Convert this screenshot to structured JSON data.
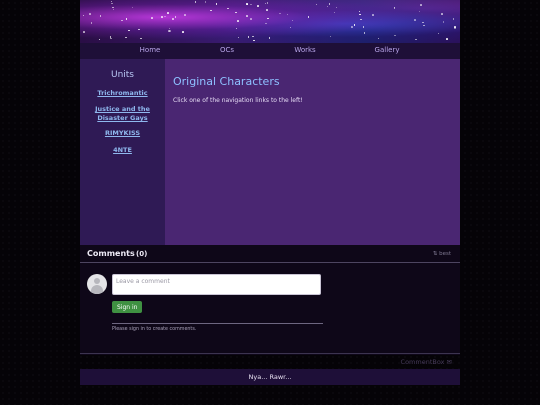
{
  "nav": {
    "items": [
      {
        "label": "Home"
      },
      {
        "label": "OCs"
      },
      {
        "label": "Works"
      },
      {
        "label": "Gallery"
      }
    ]
  },
  "sidebar": {
    "title": "Units",
    "items": [
      {
        "label": "Trichromantic"
      },
      {
        "label": "Justice and the Disaster Gays"
      },
      {
        "label": "RIMYKISS"
      },
      {
        "label": "4NTE"
      }
    ]
  },
  "main": {
    "title": "Original Characters",
    "intro": "Click one of the navigation links to the left!"
  },
  "comments": {
    "title": "Comments",
    "count": "(0)",
    "sort_label": "⇅ best",
    "input_placeholder": "Leave a comment",
    "sign_in_label": "Sign in",
    "sign_in_note": "Please sign in to create comments.",
    "powered_by": "CommentBox"
  },
  "footer": {
    "text": "Nya... Rawr..."
  },
  "colors": {
    "nav_bg": "#1e0f38",
    "sidebar_bg": "#2f1a55",
    "main_bg": "#4a2672",
    "link": "#8fb8ee",
    "title": "#8ec0ff",
    "sign_in": "#3f9142"
  }
}
